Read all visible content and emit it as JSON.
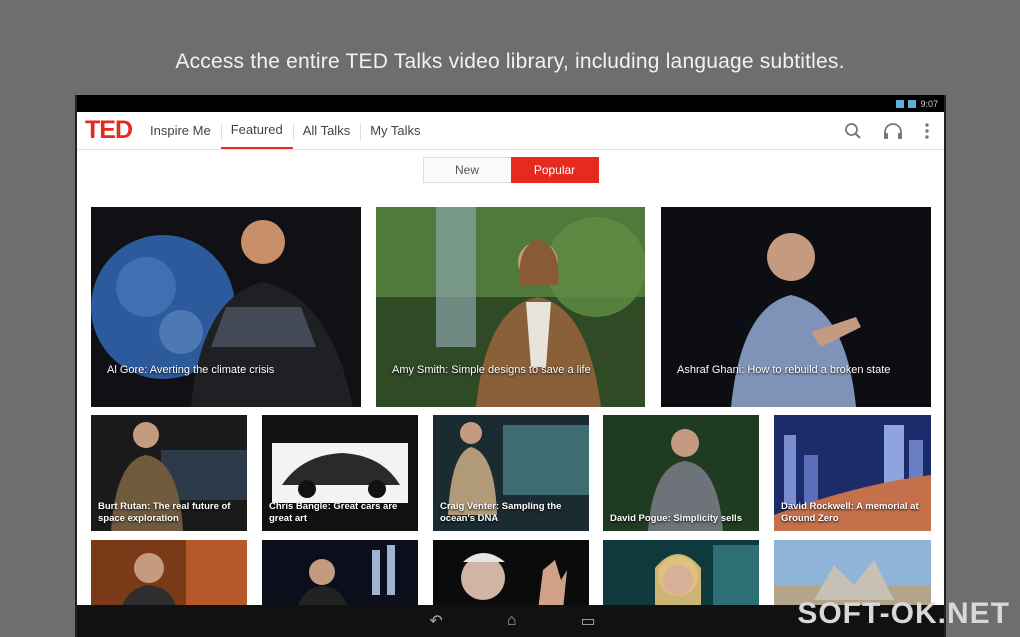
{
  "promo": {
    "headline": "Access the entire TED Talks video library, including language subtitles."
  },
  "statusbar": {
    "time": "9:07"
  },
  "app": {
    "logo": "TED",
    "tabs": [
      {
        "label": "Inspire Me"
      },
      {
        "label": "Featured"
      },
      {
        "label": "All Talks"
      },
      {
        "label": "My Talks"
      }
    ],
    "actions": {
      "search": "search-icon",
      "headphones": "headphones-icon",
      "overflow": "more-vert-icon"
    }
  },
  "toggle": {
    "new_label": "New",
    "popular_label": "Popular"
  },
  "featured": [
    {
      "title": "Al Gore: Averting the climate crisis"
    },
    {
      "title": "Amy Smith: Simple designs to save a life"
    },
    {
      "title": "Ashraf Ghani: How to rebuild a broken state"
    }
  ],
  "talks": [
    {
      "title": "Burt Rutan: The real future of space exploration"
    },
    {
      "title": "Chris Bangle: Great cars are great art"
    },
    {
      "title": "Craig Venter: Sampling the ocean's DNA"
    },
    {
      "title": "David Pogue: Simplicity sells"
    },
    {
      "title": "David Rockwell: A memorial at Ground Zero"
    }
  ],
  "navbar": {
    "back": "back-icon",
    "home": "home-icon",
    "recents": "recents-icon"
  },
  "watermark": "SOFT-OK.NET",
  "colors": {
    "accent": "#e62b1e",
    "background": "#6e6e6e"
  }
}
